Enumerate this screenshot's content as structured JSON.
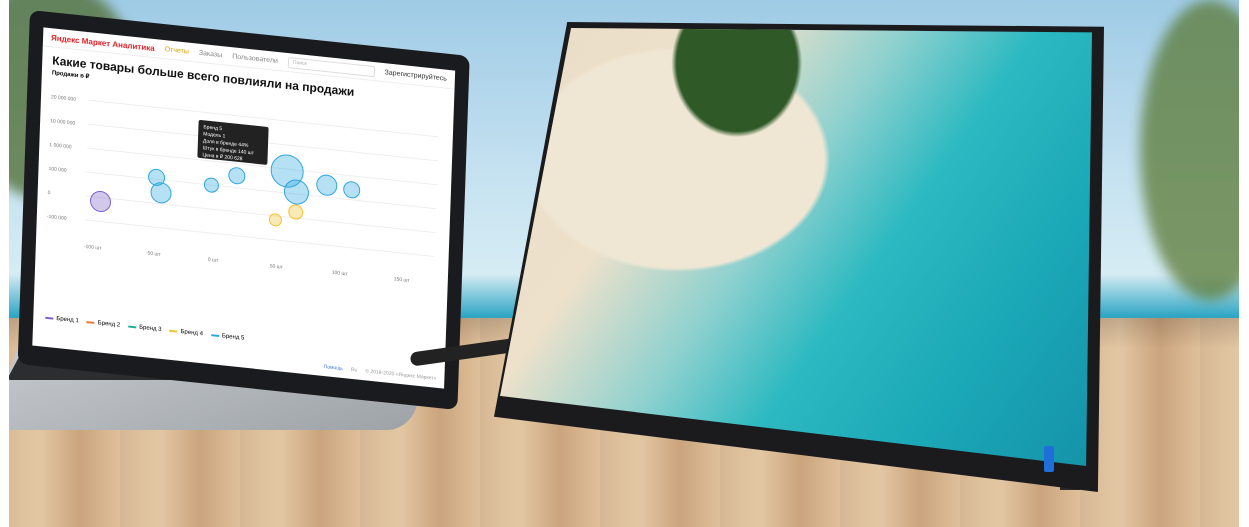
{
  "app": {
    "logo_text": "Яндекс Маркет Аналитика",
    "nav": [
      "Отчеты",
      "Заказы",
      "Пользователи"
    ],
    "search_placeholder": "Поиск",
    "user": "Зарегистрируйтесь"
  },
  "report": {
    "title": "Какие товары больше всего повлияли на продажи",
    "subtitle": "Продажи в ₽"
  },
  "footer": {
    "help": "Помощь",
    "lang": "Ru",
    "copyright": "© 2018-2020 «Яндекс.Маркет»"
  },
  "tooltip": {
    "lines": [
      "Бренд 5",
      "Модель 1",
      "Доля в бренде 44%",
      "Штук в бренде 140 шт",
      "Цена в ₽ 200 628"
    ]
  },
  "chart_data": {
    "type": "scatter",
    "title": "Какие товары больше всего повлияли на продажи",
    "ylabel": "Продажи в ₽",
    "y_ticks": [
      "20 000 000",
      "10 000 000",
      "1 000 000",
      "100 000",
      "0",
      "-100 000"
    ],
    "x_ticks": [
      "-100 шт",
      "-50 шт",
      "0 шт",
      "50 шт",
      "100 шт",
      "150 шт"
    ],
    "series": [
      {
        "name": "Бренд 1",
        "color": "#7b61c9"
      },
      {
        "name": "Бренд 2",
        "color": "#f07a3a"
      },
      {
        "name": "Бренд 3",
        "color": "#1eb39b"
      },
      {
        "name": "Бренд 4",
        "color": "#f2c230"
      },
      {
        "name": "Бренд 5",
        "color": "#2ea7e0"
      }
    ],
    "grid": true,
    "legend": "bottom-left"
  },
  "colors": {
    "accent": "#2ea7e0",
    "logo": "#e31e24"
  }
}
